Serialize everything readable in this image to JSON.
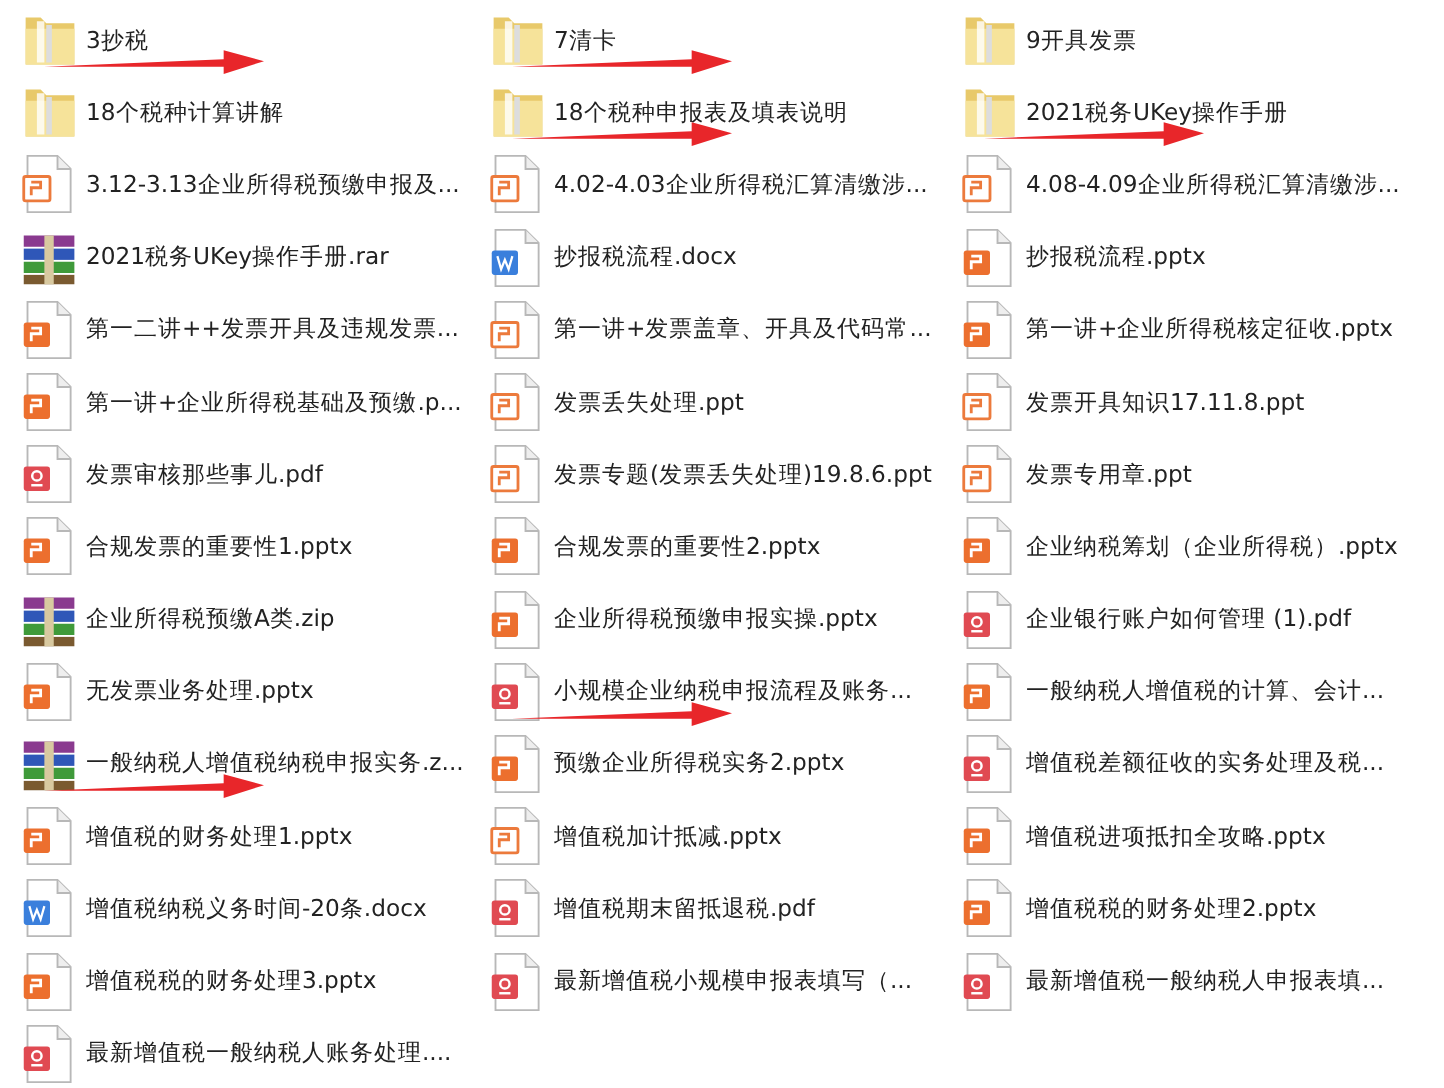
{
  "files": [
    {
      "name": "3抄税",
      "kind": "folder",
      "arrow": true
    },
    {
      "name": "7清卡",
      "kind": "folder",
      "arrow": true
    },
    {
      "name": "9开具发票",
      "kind": "folder",
      "arrow": false
    },
    {
      "name": "18个税种计算讲解",
      "kind": "folder",
      "arrow": false
    },
    {
      "name": "18个税种申报表及填表说明",
      "kind": "folder",
      "arrow": true
    },
    {
      "name": "2021税务UKey操作手册",
      "kind": "folder",
      "arrow": true
    },
    {
      "name": "3.12-3.13企业所得税预缴申报及...",
      "kind": "ppt",
      "arrow": false
    },
    {
      "name": "4.02-4.03企业所得税汇算清缴涉...",
      "kind": "ppt",
      "arrow": false
    },
    {
      "name": "4.08-4.09企业所得税汇算清缴涉...",
      "kind": "ppt",
      "arrow": false
    },
    {
      "name": "2021税务UKey操作手册.rar",
      "kind": "archive",
      "arrow": false
    },
    {
      "name": "抄报税流程.docx",
      "kind": "docx",
      "arrow": false
    },
    {
      "name": "抄报税流程.pptx",
      "kind": "pptx",
      "arrow": false
    },
    {
      "name": "第一二讲++发票开具及违规发票...",
      "kind": "pptx",
      "arrow": false
    },
    {
      "name": "第一讲+发票盖章、开具及代码常...",
      "kind": "ppt",
      "arrow": false
    },
    {
      "name": "第一讲+企业所得税核定征收.pptx",
      "kind": "pptx",
      "arrow": false
    },
    {
      "name": "第一讲+企业所得税基础及预缴.p...",
      "kind": "pptx",
      "arrow": false
    },
    {
      "name": "发票丢失处理.ppt",
      "kind": "ppt",
      "arrow": false
    },
    {
      "name": "发票开具知识17.11.8.ppt",
      "kind": "ppt",
      "arrow": false
    },
    {
      "name": "发票审核那些事儿.pdf",
      "kind": "pdf",
      "arrow": false
    },
    {
      "name": "发票专题(发票丢失处理)19.8.6.ppt",
      "kind": "ppt",
      "arrow": false
    },
    {
      "name": "发票专用章.ppt",
      "kind": "ppt",
      "arrow": false
    },
    {
      "name": "合规发票的重要性1.pptx",
      "kind": "pptx",
      "arrow": false
    },
    {
      "name": "合规发票的重要性2.pptx",
      "kind": "pptx",
      "arrow": false
    },
    {
      "name": "企业纳税筹划（企业所得税）.pptx",
      "kind": "pptx",
      "arrow": false
    },
    {
      "name": "企业所得税预缴A类.zip",
      "kind": "archive",
      "arrow": false
    },
    {
      "name": "企业所得税预缴申报实操.pptx",
      "kind": "pptx",
      "arrow": false
    },
    {
      "name": "企业银行账户如何管理 (1).pdf",
      "kind": "pdf",
      "arrow": false
    },
    {
      "name": "无发票业务处理.pptx",
      "kind": "pptx",
      "arrow": false
    },
    {
      "name": "小规模企业纳税申报流程及账务...",
      "kind": "pdf",
      "arrow": true
    },
    {
      "name": "一般纳税人增值税的计算、会计...",
      "kind": "pptx",
      "arrow": false
    },
    {
      "name": "一般纳税人增值税纳税申报实务.z...",
      "kind": "archive",
      "arrow": true
    },
    {
      "name": "预缴企业所得税实务2.pptx",
      "kind": "pptx",
      "arrow": false
    },
    {
      "name": "增值税差额征收的实务处理及税...",
      "kind": "pdf",
      "arrow": false
    },
    {
      "name": "增值税的财务处理1.pptx",
      "kind": "pptx",
      "arrow": false
    },
    {
      "name": "增值税加计抵减.pptx",
      "kind": "ppt",
      "arrow": false
    },
    {
      "name": "增值税进项抵扣全攻略.pptx",
      "kind": "pptx",
      "arrow": false
    },
    {
      "name": "增值税纳税义务时间-20条.docx",
      "kind": "docx",
      "arrow": false
    },
    {
      "name": "增值税期末留抵退税.pdf",
      "kind": "pdf",
      "arrow": false
    },
    {
      "name": "增值税税的财务处理2.pptx",
      "kind": "pptx",
      "arrow": false
    },
    {
      "name": "增值税税的财务处理3.pptx",
      "kind": "pptx",
      "arrow": false
    },
    {
      "name": "最新增值税小规模申报表填写（...",
      "kind": "pdf",
      "arrow": false
    },
    {
      "name": "最新增值税一般纳税人申报表填...",
      "kind": "pdf",
      "arrow": false
    },
    {
      "name": "最新增值税一般纳税人账务处理....",
      "kind": "pdf",
      "arrow": false
    }
  ]
}
